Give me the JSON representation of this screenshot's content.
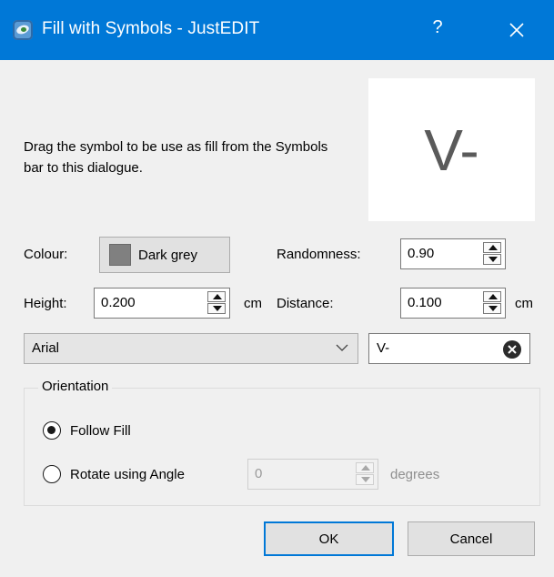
{
  "window": {
    "title": "Fill with Symbols - JustEDIT",
    "help_label": "?"
  },
  "instructions": "Drag the symbol to be use as fill from the Symbols bar to this dialogue.",
  "preview_symbol": "V-",
  "colour": {
    "label": "Colour:",
    "value": "Dark grey",
    "swatch_color": "#808080"
  },
  "randomness": {
    "label": "Randomness:",
    "value": "0.90"
  },
  "height": {
    "label": "Height:",
    "value": "0.200",
    "unit": "cm"
  },
  "distance": {
    "label": "Distance:",
    "value": "0.100",
    "unit": "cm"
  },
  "font": {
    "value": "Arial"
  },
  "symbol_text": "V-",
  "orientation": {
    "title": "Orientation",
    "follow_fill": "Follow Fill",
    "rotate_label": "Rotate using Angle",
    "angle_value": "0",
    "angle_unit": "degrees"
  },
  "buttons": {
    "ok": "OK",
    "cancel": "Cancel"
  },
  "colors": {
    "titlebar": "#0078d7",
    "default_button_border": "#0078d7"
  }
}
